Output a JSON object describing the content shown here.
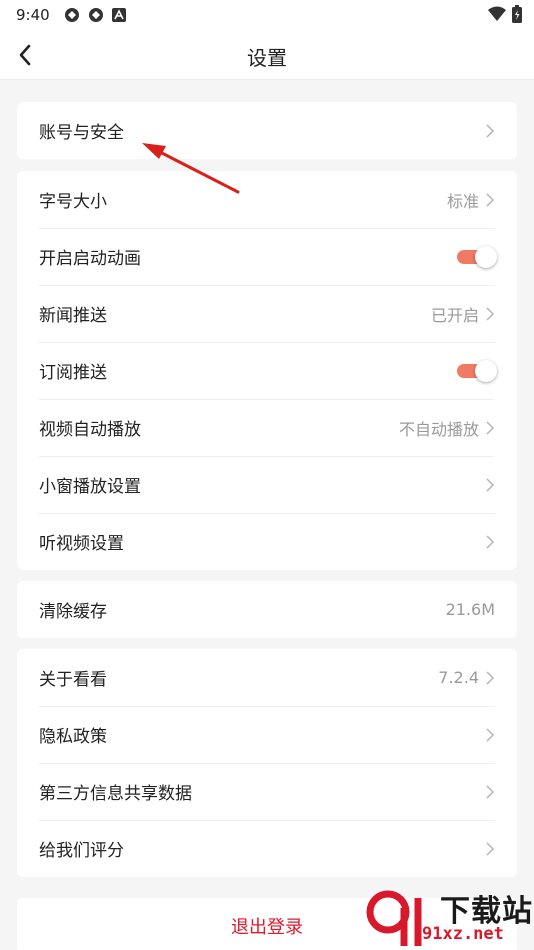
{
  "status_bar": {
    "time": "9:40"
  },
  "header": {
    "title": "设置",
    "back_icon": "chevron-left-icon"
  },
  "account_section": {
    "items": [
      {
        "label": "账号与安全",
        "value": ""
      }
    ]
  },
  "display_section": {
    "items": [
      {
        "label": "字号大小",
        "value": "标准"
      },
      {
        "label": "开启启动动画",
        "toggle": true
      },
      {
        "label": "新闻推送",
        "value": "已开启"
      },
      {
        "label": "订阅推送",
        "toggle": true
      },
      {
        "label": "视频自动播放",
        "value": "不自动播放"
      },
      {
        "label": "小窗播放设置",
        "value": ""
      },
      {
        "label": "听视频设置",
        "value": ""
      }
    ]
  },
  "cache_section": {
    "label": "清除缓存",
    "value": "21.6M"
  },
  "about_section": {
    "items": [
      {
        "label": "关于看看",
        "value": "7.2.4"
      },
      {
        "label": "隐私政策",
        "value": ""
      },
      {
        "label": "第三方信息共享数据",
        "value": ""
      },
      {
        "label": "给我们评分",
        "value": ""
      }
    ]
  },
  "logout": {
    "label": "退出登录"
  },
  "watermark": {
    "logo_text": "91",
    "title": "下载站",
    "url": "91xz.net"
  },
  "colors": {
    "accent_toggle": "#f07a62",
    "logout_red": "#e2192c",
    "background": "#f5f5f5",
    "annotation_arrow": "#d9211c"
  }
}
